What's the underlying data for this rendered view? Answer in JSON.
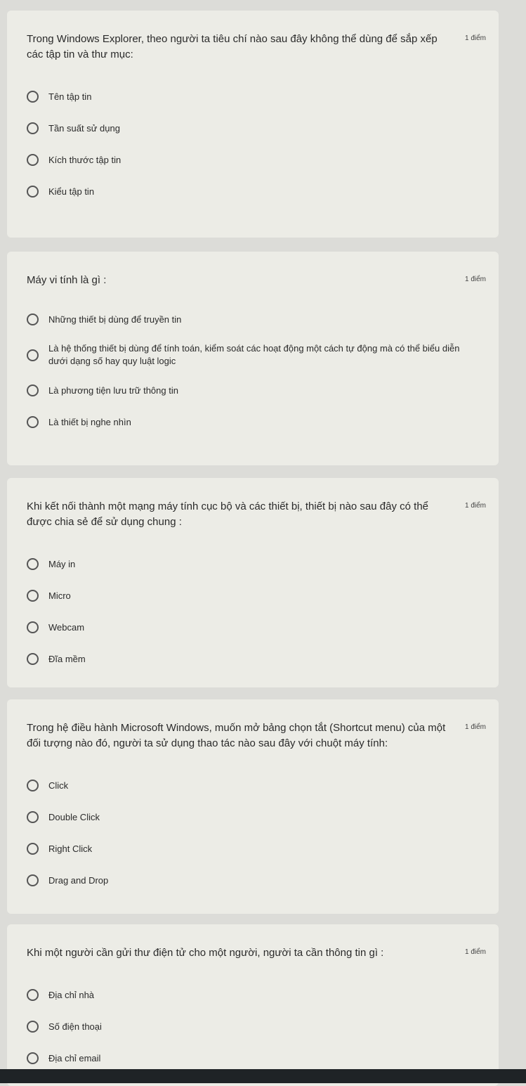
{
  "questions": [
    {
      "text": "Trong Windows Explorer, theo người ta tiêu chí nào sau đây không thể dùng để sắp xếp các tập tin và thư mục:",
      "points": "1 điểm",
      "options": [
        "Tên tập tin",
        "Tần suất sử dụng",
        "Kích thước tập tin",
        "Kiểu tập tin"
      ]
    },
    {
      "text": "Máy vi tính là gì :",
      "points": "1 điểm",
      "options": [
        "Những thiết bị dùng để truyền tin",
        "Là hệ thống thiết bị dùng để tính toán, kiểm soát các hoạt động một cách tự động mà có thể biểu diễn dưới dạng số hay quy luật logic",
        "Là phương tiện lưu trữ thông tin",
        "Là thiết bị nghe nhìn"
      ]
    },
    {
      "text": "Khi kết nối thành một mạng máy tính cục bộ và các thiết bị, thiết bị nào sau đây có thể được chia sẻ để sử dụng chung :",
      "points": "1 điểm",
      "options": [
        "Máy in",
        "Micro",
        "Webcam",
        "Đĩa mềm"
      ]
    },
    {
      "text": "Trong hệ điều hành Microsoft Windows, muốn mở bảng chọn tắt (Shortcut menu) của một đối tượng nào đó, người ta sử dụng thao tác nào sau đây với chuột máy tính:",
      "points": "1 điểm",
      "options": [
        "Click",
        "Double Click",
        "Right Click",
        "Drag and Drop"
      ]
    },
    {
      "text": "Khi một người cần gửi thư điện tử cho một người, người ta cần thông tin gì :",
      "points": "1 điểm",
      "options": [
        "Địa chỉ nhà",
        "Số điện thoại",
        "Địa chỉ email"
      ]
    }
  ]
}
